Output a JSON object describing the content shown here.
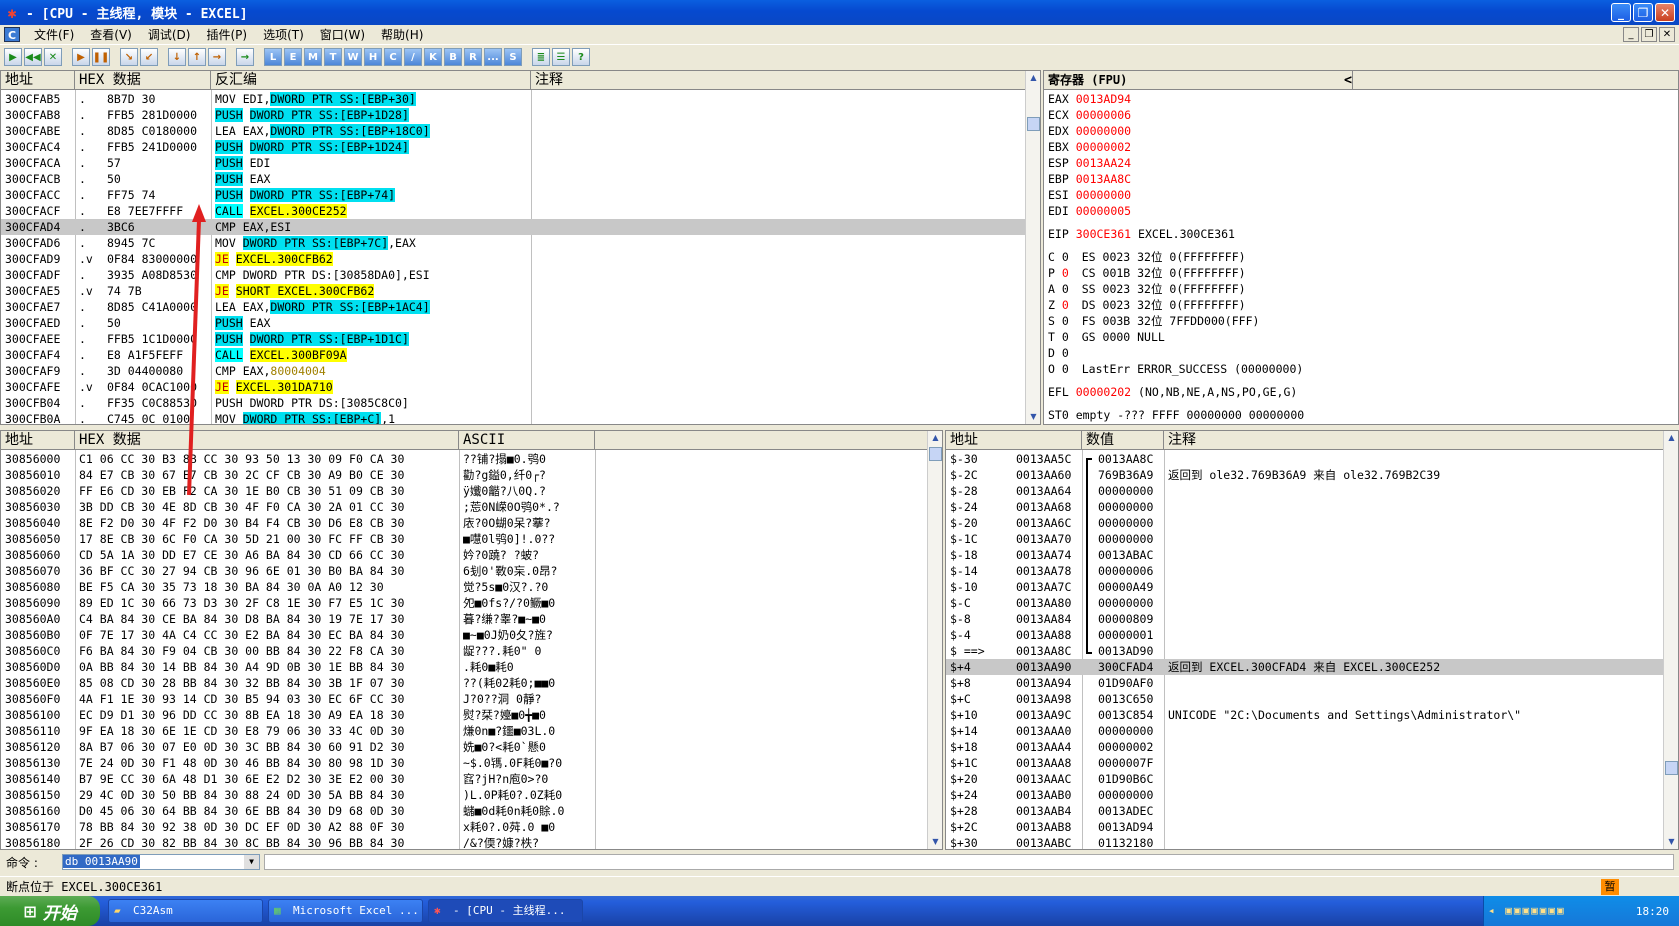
{
  "window": {
    "title": " - [CPU - 主线程, 模块 - EXCEL]",
    "buttons": [
      "_",
      "❐",
      "✕"
    ]
  },
  "menu": {
    "icon": "C",
    "items": [
      "文件(F)",
      "查看(V)",
      "调试(D)",
      "插件(P)",
      "选项(T)",
      "窗口(W)",
      "帮助(H)"
    ],
    "mdi": [
      "_",
      "❐",
      "✕"
    ]
  },
  "toolbar": {
    "buttons": [
      "▶",
      "◀◀",
      "✕",
      "▶",
      "❚❚",
      "↘",
      "↙",
      "↓",
      "↑",
      "→",
      "→",
      "L",
      "E",
      "M",
      "T",
      "W",
      "H",
      "C",
      "/",
      "K",
      "B",
      "R",
      "...",
      "S",
      "≣",
      "☰",
      "?"
    ]
  },
  "disasm": {
    "headers": [
      "地址",
      "HEX 数据",
      "反汇编",
      "注释"
    ],
    "rows": [
      {
        "addr": "300CFAB5",
        "mk": ".",
        "hex": "8B7D 30",
        "a": "MOV EDI,",
        "b": "DWORD PTR SS:[EBP+30]",
        "c": "",
        "t": "mov"
      },
      {
        "addr": "300CFAB8",
        "mk": ".",
        "hex": "FFB5 281D0000",
        "a": "PUSH",
        "b": "DWORD PTR SS:[EBP+1D28]",
        "c": "",
        "t": "push"
      },
      {
        "addr": "300CFABE",
        "mk": ".",
        "hex": "8D85 C0180000",
        "a": "LEA EAX,",
        "b": "DWORD PTR SS:[EBP+18C0]",
        "c": "",
        "t": "mov"
      },
      {
        "addr": "300CFAC4",
        "mk": ".",
        "hex": "FFB5 241D0000",
        "a": "PUSH",
        "b": "DWORD PTR SS:[EBP+1D24]",
        "c": "",
        "t": "push"
      },
      {
        "addr": "300CFACA",
        "mk": ".",
        "hex": "57",
        "a": "PUSH",
        "b": "EDI",
        "c": "",
        "t": "pushr"
      },
      {
        "addr": "300CFACB",
        "mk": ".",
        "hex": "50",
        "a": "PUSH",
        "b": "EAX",
        "c": "",
        "t": "pushr"
      },
      {
        "addr": "300CFACC",
        "mk": ".",
        "hex": "FF75 74",
        "a": "PUSH",
        "b": "DWORD PTR SS:[EBP+74]",
        "c": "",
        "t": "push"
      },
      {
        "addr": "300CFACF",
        "mk": ".",
        "hex": "E8 7EE7FFFF",
        "a": "CALL",
        "b": "EXCEL.300CE252",
        "c": "",
        "t": "call"
      },
      {
        "addr": "300CFAD4",
        "mk": ".",
        "hex": "3BC6",
        "a": "CMP EAX,ESI",
        "b": "",
        "c": "",
        "t": "sel"
      },
      {
        "addr": "300CFAD6",
        "mk": ".",
        "hex": "8945 7C",
        "a": "MOV",
        "b": "DWORD PTR SS:[EBP+7C]",
        "c": ",EAX",
        "t": "mov2"
      },
      {
        "addr": "300CFAD9",
        "mk": ".v",
        "hex": "0F84 83000000",
        "a": "JE",
        "b": "EXCEL.300CFB62",
        "c": "",
        "t": "jmp"
      },
      {
        "addr": "300CFADF",
        "mk": ".",
        "hex": "3935 A08D8530",
        "a": "CMP DWORD PTR DS:[30858DA0],ESI",
        "b": "",
        "c": "",
        "t": "plain"
      },
      {
        "addr": "300CFAE5",
        "mk": ".v",
        "hex": "74 7B",
        "a": "JE",
        "b": "SHORT EXCEL.300CFB62",
        "c": "",
        "t": "jmp"
      },
      {
        "addr": "300CFAE7",
        "mk": ".",
        "hex": "8D85 C41A0000",
        "a": "LEA EAX,",
        "b": "DWORD PTR SS:[EBP+1AC4]",
        "c": "",
        "t": "mov"
      },
      {
        "addr": "300CFAED",
        "mk": ".",
        "hex": "50",
        "a": "PUSH",
        "b": "EAX",
        "c": "",
        "t": "pushr"
      },
      {
        "addr": "300CFAEE",
        "mk": ".",
        "hex": "FFB5 1C1D0000",
        "a": "PUSH",
        "b": "DWORD PTR SS:[EBP+1D1C]",
        "c": "",
        "t": "push"
      },
      {
        "addr": "300CFAF4",
        "mk": ".",
        "hex": "E8 A1F5FEFF",
        "a": "CALL",
        "b": "EXCEL.300BF09A",
        "c": "",
        "t": "call"
      },
      {
        "addr": "300CFAF9",
        "mk": ".",
        "hex": "3D 04400080",
        "a": "CMP EAX,",
        "b": "80004004",
        "c": "",
        "t": "const"
      },
      {
        "addr": "300CFAFE",
        "mk": ".v",
        "hex": "0F84 0CAC1000",
        "a": "JE",
        "b": "EXCEL.301DA710",
        "c": "",
        "t": "jmp"
      },
      {
        "addr": "300CFB04",
        "mk": ".",
        "hex": "FF35 C0C88530",
        "a": "PUSH DWORD PTR DS:[3085C8C0]",
        "b": "",
        "c": "",
        "t": "plain"
      },
      {
        "addr": "300CFB0A",
        "mk": ".",
        "hex": "C745 0C 0100",
        "a": "MOV",
        "b": "DWORD PTR SS:[EBP+C]",
        "c": ",1",
        "t": "mov2"
      }
    ]
  },
  "registers": {
    "title": "寄存器 (FPU)",
    "arrows": [
      "<",
      "<",
      "<",
      "<",
      "<",
      "<",
      "<",
      "<",
      "<"
    ],
    "gpr": [
      {
        "n": "EAX",
        "v": "0013AD94"
      },
      {
        "n": "ECX",
        "v": "00000006"
      },
      {
        "n": "EDX",
        "v": "00000000"
      },
      {
        "n": "EBX",
        "v": "00000002"
      },
      {
        "n": "ESP",
        "v": "0013AA24"
      },
      {
        "n": "EBP",
        "v": "0013AA8C"
      },
      {
        "n": "ESI",
        "v": "00000000"
      },
      {
        "n": "EDI",
        "v": "00000005"
      }
    ],
    "eip": {
      "n": "EIP",
      "v": "300CE361",
      "c": "EXCEL.300CE361"
    },
    "flags": [
      {
        "f": "C",
        "b": "0",
        "d": "ES 0023 32位 0(FFFFFFFF)",
        "red": false
      },
      {
        "f": "P",
        "b": "0",
        "d": "CS 001B 32位 0(FFFFFFFF)",
        "red": true
      },
      {
        "f": "A",
        "b": "0",
        "d": "SS 0023 32位 0(FFFFFFFF)",
        "red": false
      },
      {
        "f": "Z",
        "b": "0",
        "d": "DS 0023 32位 0(FFFFFFFF)",
        "red": true
      },
      {
        "f": "S",
        "b": "0",
        "d": "FS 003B 32位 7FFDD000(FFF)",
        "red": false
      },
      {
        "f": "T",
        "b": "0",
        "d": "GS 0000 NULL",
        "red": false
      },
      {
        "f": "D",
        "b": "0",
        "d": "",
        "red": false
      },
      {
        "f": "O",
        "b": "0",
        "d": "LastErr ERROR_SUCCESS (00000000)",
        "red": false
      }
    ],
    "efl": {
      "n": "EFL",
      "v": "00000202",
      "d": "(NO,NB,NE,A,NS,PO,GE,G)"
    },
    "st0": "ST0 empty -??? FFFF 00000000 00000000"
  },
  "dump": {
    "headers": [
      "地址",
      "HEX 数据",
      "ASCII"
    ],
    "rows": [
      {
        "a": "30856000",
        "h": "C1 06 CC 30 B3 8B CC 30 93 50 13 30 09 F0 CA 30",
        "s": "??铺?搨■0.鸮0"
      },
      {
        "a": "30856010",
        "h": "84 E7 CB 30 67 E7 CB 30 2C CF CB 30 A9 B0 CE 30",
        "s": "勸?g鎰0,纤0┌?"
      },
      {
        "a": "30856020",
        "h": "FF E6 CD 30 EB F2 CA 30 1E B0 CB 30 51 09 CB 30",
        "s": "ÿ孅0龤?八0Q.?"
      },
      {
        "a": "30856030",
        "h": "3B DD CB 30 4E 8D CB 30 4F F0 CA 30 2A 01 CC 30",
        "s": ";莣0N嵘0O鸮0*.?"
      },
      {
        "a": "30856040",
        "h": "8E F2 D0 30 4F F2 D0 30 B4 F4 CB 30 D6 E8 CB 30",
        "s": "庡?0O蝴0呆?藆?"
      },
      {
        "a": "30856050",
        "h": "17 8E CB 30 6C F0 CA 30 5D 21 00 30 FC FF CB 30",
        "s": "■嚖0l鸮0]!.0??"
      },
      {
        "a": "30856060",
        "h": "CD 5A 1A 30 DD E7 CE 30 A6 BA 84 30 CD 66 CC 30",
        "s": "妗?0蹺?  ?蚾?"
      },
      {
        "a": "30856070",
        "h": "36 BF CC 30 27 94 CB 30 96 6E 01 30 B0 BA 84 30",
        "s": "6刬0'斁0杗.0昂?"
      },
      {
        "a": "30856080",
        "h": "BE F5 CA 30 35 73 18 30 BA 84 30 0A A0 12 30",
        "s": "觉?5s■0汉?.?0"
      },
      {
        "a": "30856090",
        "h": "89 ED 1C 30 66 73 D3 30 2F C8 1E 30 F7 E5 1C 30",
        "s": "夗■0fs?/?0鳜■0"
      },
      {
        "a": "308560A0",
        "h": "C4 BA 84 30 CE BA 84 30 D8 BA 84 30 19 7E 17 30",
        "s": "暮?缣?睾?■~■0"
      },
      {
        "a": "308560B0",
        "h": "0F 7E 17 30 4A C4 CC 30 E2 BA 84 30 EC BA 84 30",
        "s": "■~■0J奶0夂?旌?"
      },
      {
        "a": "308560C0",
        "h": "F6 BA 84 30 F9 04 CB 30 00 BB 84 30 22 F8 CA 30",
        "s": "龊???.耗0\"  0"
      },
      {
        "a": "308560D0",
        "h": "0A BB 84 30 14 BB 84 30 A4 9D 0B 30 1E BB 84 30",
        "s": ".耗0■耗0"
      },
      {
        "a": "308560E0",
        "h": "85 08 CD 30 28 BB 84 30 32 BB 84 30 3B 1F 07 30",
        "s": "??(耗02耗0;■■0"
      },
      {
        "a": "308560F0",
        "h": "4A F1 1E 30 93 14 CD 30 B5 94 03 30 EC 6F CC 30",
        "s": "J?0??洞 0靜?"
      },
      {
        "a": "30856100",
        "h": "EC D9 D1 30 96 DD CC 30 8B EA 18 30 A9 EA 18 30",
        "s": "熨?栞?嬯■0╈■0"
      },
      {
        "a": "30856110",
        "h": "9F EA 18 30 6E 1E CD 30 E8 79 06 30 33 4C 0D 30",
        "s": "熑0n■?鑩■03L.0"
      },
      {
        "a": "30856120",
        "h": "8A B7 06 30 07 E0 0D 30 3C BB 84 30 60 91 D2 30",
        "s": "姺■0?<耗0`懸0"
      },
      {
        "a": "30856130",
        "h": "7E 24 0D 30 F1 48 0D 30 46 BB 84 30 80 98 1D 30",
        "s": "~$.0駂.0F耗0■?0"
      },
      {
        "a": "30856140",
        "h": "B7 9E CC 30 6A 48 D1 30 6E E2 D2 30 3E E2 00 30",
        "s": "窞?jH?n庖0>?0"
      },
      {
        "a": "30856150",
        "h": "29 4C 0D 30 50 BB 84 30 88 24 0D 30 5A BB 84 30",
        "s": ")L.0P耗0?.0Z耗0"
      },
      {
        "a": "30856160",
        "h": "D0 45 06 30 64 BB 84 30 6E BB 84 30 D9 68 0D 30",
        "s": "蠩■0d耗0n耗0賖.0"
      },
      {
        "a": "30856170",
        "h": "78 BB 84 30 92 38 0D 30 DC EF 0D 30 A2 88 0F 30",
        "s": "x耗0?.0荈.0  ■0"
      },
      {
        "a": "30856180",
        "h": "2F 26 CD 30 82 BB 84 30 8C BB 84 30 96 BB 84 30",
        "s": "/&?偄?嫝?柣?"
      }
    ]
  },
  "stack": {
    "headers": [
      "地址",
      "数值",
      "注释"
    ],
    "rows": [
      {
        "o": "$-30",
        "a": "0013AA5C",
        "v": "0013AA8C",
        "c": "",
        "s": false
      },
      {
        "o": "$-2C",
        "a": "0013AA60",
        "v": "769B36A9",
        "c": "返回到 ole32.769B36A9 来自 ole32.769B2C39",
        "s": false
      },
      {
        "o": "$-28",
        "a": "0013AA64",
        "v": "00000000",
        "c": "",
        "s": false
      },
      {
        "o": "$-24",
        "a": "0013AA68",
        "v": "00000000",
        "c": "",
        "s": false
      },
      {
        "o": "$-20",
        "a": "0013AA6C",
        "v": "00000000",
        "c": "",
        "s": false
      },
      {
        "o": "$-1C",
        "a": "0013AA70",
        "v": "00000000",
        "c": "",
        "s": false
      },
      {
        "o": "$-18",
        "a": "0013AA74",
        "v": "0013ABAC",
        "c": "",
        "s": false
      },
      {
        "o": "$-14",
        "a": "0013AA78",
        "v": "00000006",
        "c": "",
        "s": false
      },
      {
        "o": "$-10",
        "a": "0013AA7C",
        "v": "00000A49",
        "c": "",
        "s": false
      },
      {
        "o": "$-C",
        "a": "0013AA80",
        "v": "00000000",
        "c": "",
        "s": false
      },
      {
        "o": "$-8",
        "a": "0013AA84",
        "v": "00000809",
        "c": "",
        "s": false
      },
      {
        "o": "$-4",
        "a": "0013AA88",
        "v": "00000001",
        "c": "",
        "s": false
      },
      {
        "o": "$ ==>",
        "a": "0013AA8C",
        "v": "0013AD90",
        "c": "",
        "s": false
      },
      {
        "o": "$+4",
        "a": "0013AA90",
        "v": "300CFAD4",
        "c": "返回到 EXCEL.300CFAD4 来自 EXCEL.300CE252",
        "s": true
      },
      {
        "o": "$+8",
        "a": "0013AA94",
        "v": "01D90AF0",
        "c": "",
        "s": false
      },
      {
        "o": "$+C",
        "a": "0013AA98",
        "v": "0013C650",
        "c": "",
        "s": false
      },
      {
        "o": "$+10",
        "a": "0013AA9C",
        "v": "0013C854",
        "c": "UNICODE \"2C:\\Documents and Settings\\Administrator\\\"",
        "s": false
      },
      {
        "o": "$+14",
        "a": "0013AAA0",
        "v": "00000000",
        "c": "",
        "s": false
      },
      {
        "o": "$+18",
        "a": "0013AAA4",
        "v": "00000002",
        "c": "",
        "s": false
      },
      {
        "o": "$+1C",
        "a": "0013AAA8",
        "v": "0000007F",
        "c": "",
        "s": false
      },
      {
        "o": "$+20",
        "a": "0013AAAC",
        "v": "01D90B6C",
        "c": "",
        "s": false
      },
      {
        "o": "$+24",
        "a": "0013AAB0",
        "v": "00000000",
        "c": "",
        "s": false
      },
      {
        "o": "$+28",
        "a": "0013AAB4",
        "v": "0013ADEC",
        "c": "",
        "s": false
      },
      {
        "o": "$+2C",
        "a": "0013AAB8",
        "v": "0013AD94",
        "c": "",
        "s": false
      },
      {
        "o": "$+30",
        "a": "0013AABC",
        "v": "01132180",
        "c": "",
        "s": false
      }
    ]
  },
  "command": {
    "label": "命令 :",
    "value": "db 0013AA90"
  },
  "status": "断点位于 EXCEL.300CE361",
  "taskbar": {
    "start": "开始",
    "items": [
      "C32Asm",
      "Microsoft Excel ...",
      "- [CPU - 主线程..."
    ],
    "time": "18:20"
  }
}
